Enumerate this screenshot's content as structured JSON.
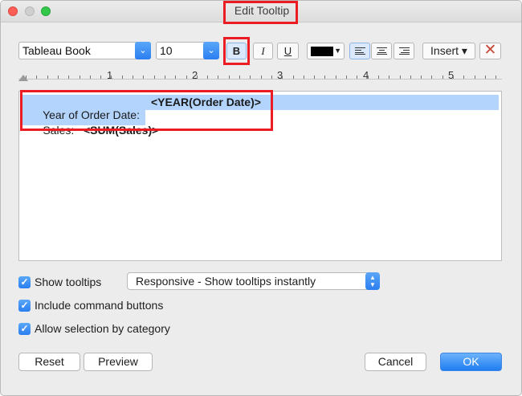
{
  "window": {
    "title": "Edit Tooltip"
  },
  "toolbar": {
    "font_family": "Tableau Book",
    "font_size": "10",
    "bold_label": "B",
    "italic_label": "I",
    "underline_label": "U",
    "text_color": "#000000",
    "insert_label": "Insert ▾",
    "clear_label": "✕"
  },
  "ruler": {
    "marks": [
      "1",
      "2",
      "3",
      "4",
      "5"
    ]
  },
  "editor": {
    "line1_label": "Year of Order Date:",
    "line1_field": "<YEAR(Order Date)>",
    "line2_label": "Sales:   ",
    "line2_field": "<SUM(Sales)>",
    "selection_color": "#b3d4fd"
  },
  "options": {
    "show_tooltips": {
      "label": "Show tooltips",
      "checked": true
    },
    "tooltip_mode": "Responsive - Show tooltips instantly",
    "include_command_buttons": {
      "label": "Include command buttons",
      "checked": true
    },
    "allow_selection_by_category": {
      "label": "Allow selection by category",
      "checked": true
    }
  },
  "buttons": {
    "reset": "Reset",
    "preview": "Preview",
    "cancel": "Cancel",
    "ok": "OK"
  },
  "colors": {
    "highlight_red": "#ec1c24",
    "accent_blue": "#2b7ef0"
  }
}
